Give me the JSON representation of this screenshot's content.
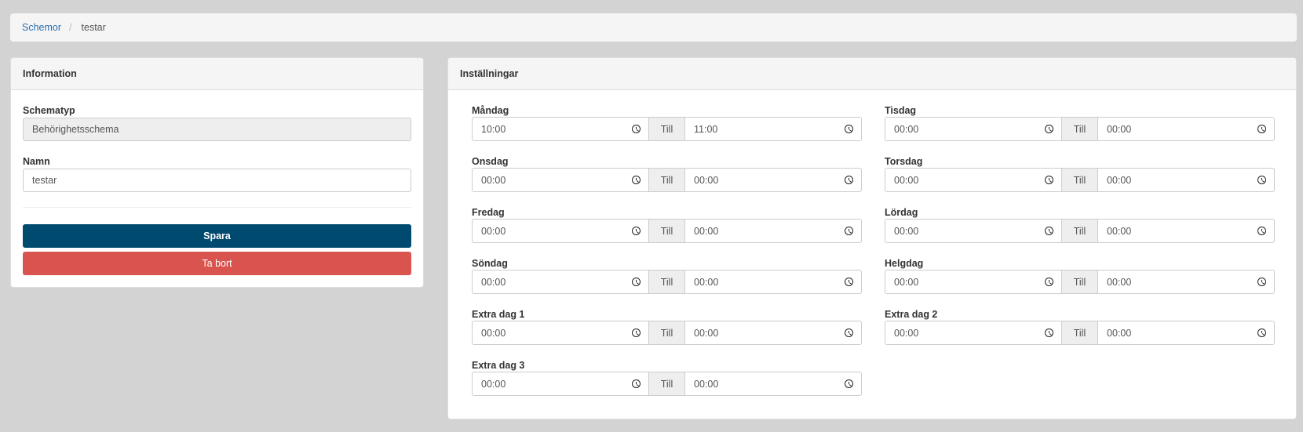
{
  "breadcrumb": {
    "parent": "Schemor",
    "separator": "/",
    "current": "testar"
  },
  "info": {
    "heading": "Information",
    "schematyp_label": "Schematyp",
    "schematyp_value": "Behörighetsschema",
    "namn_label": "Namn",
    "namn_value": "testar",
    "save_label": "Spara",
    "delete_label": "Ta bort"
  },
  "settings": {
    "heading": "Inställningar",
    "till_label": "Till",
    "days": [
      {
        "label": "Måndag",
        "from": "10:00",
        "to": "11:00"
      },
      {
        "label": "Tisdag",
        "from": "00:00",
        "to": "00:00"
      },
      {
        "label": "Onsdag",
        "from": "00:00",
        "to": "00:00"
      },
      {
        "label": "Torsdag",
        "from": "00:00",
        "to": "00:00"
      },
      {
        "label": "Fredag",
        "from": "00:00",
        "to": "00:00"
      },
      {
        "label": "Lördag",
        "from": "00:00",
        "to": "00:00"
      },
      {
        "label": "Söndag",
        "from": "00:00",
        "to": "00:00"
      },
      {
        "label": "Helgdag",
        "from": "00:00",
        "to": "00:00"
      },
      {
        "label": "Extra dag 1",
        "from": "00:00",
        "to": "00:00"
      },
      {
        "label": "Extra dag 2",
        "from": "00:00",
        "to": "00:00"
      },
      {
        "label": "Extra dag 3",
        "from": "00:00",
        "to": "00:00"
      }
    ]
  },
  "colors": {
    "primary": "#004a6f",
    "danger": "#d9534f",
    "link": "#2a6fb3",
    "background": "#d3d3d3"
  },
  "icons": {
    "time_field": "clock-icon"
  }
}
